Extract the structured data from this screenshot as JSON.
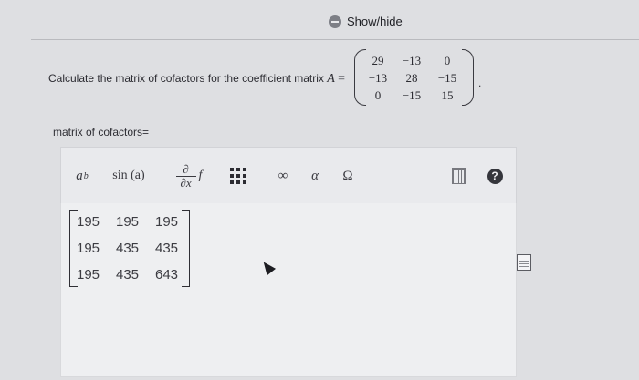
{
  "header": {
    "show_hide_label": "Show/hide"
  },
  "question": {
    "prompt": "Calculate the matrix of cofactors for the coefficient matrix",
    "variable": "A",
    "equals": "=",
    "matrix_A": [
      [
        "29",
        "−13",
        "0"
      ],
      [
        "−13",
        "28",
        "−15"
      ],
      [
        "0",
        "−15",
        "15"
      ]
    ],
    "trailing": "."
  },
  "answer": {
    "label": "matrix of cofactors=",
    "matrix": [
      [
        "195",
        "195",
        "195"
      ],
      [
        "195",
        "435",
        "435"
      ],
      [
        "195",
        "435",
        "643"
      ]
    ]
  },
  "toolbar": {
    "power_base": "a",
    "power_exp": "b",
    "sin": "sin (a)",
    "partial_top": "∂",
    "partial_bottom": "∂x",
    "partial_f": "f",
    "infinity": "∞",
    "alpha": "α",
    "omega": "Ω",
    "help": "?"
  }
}
